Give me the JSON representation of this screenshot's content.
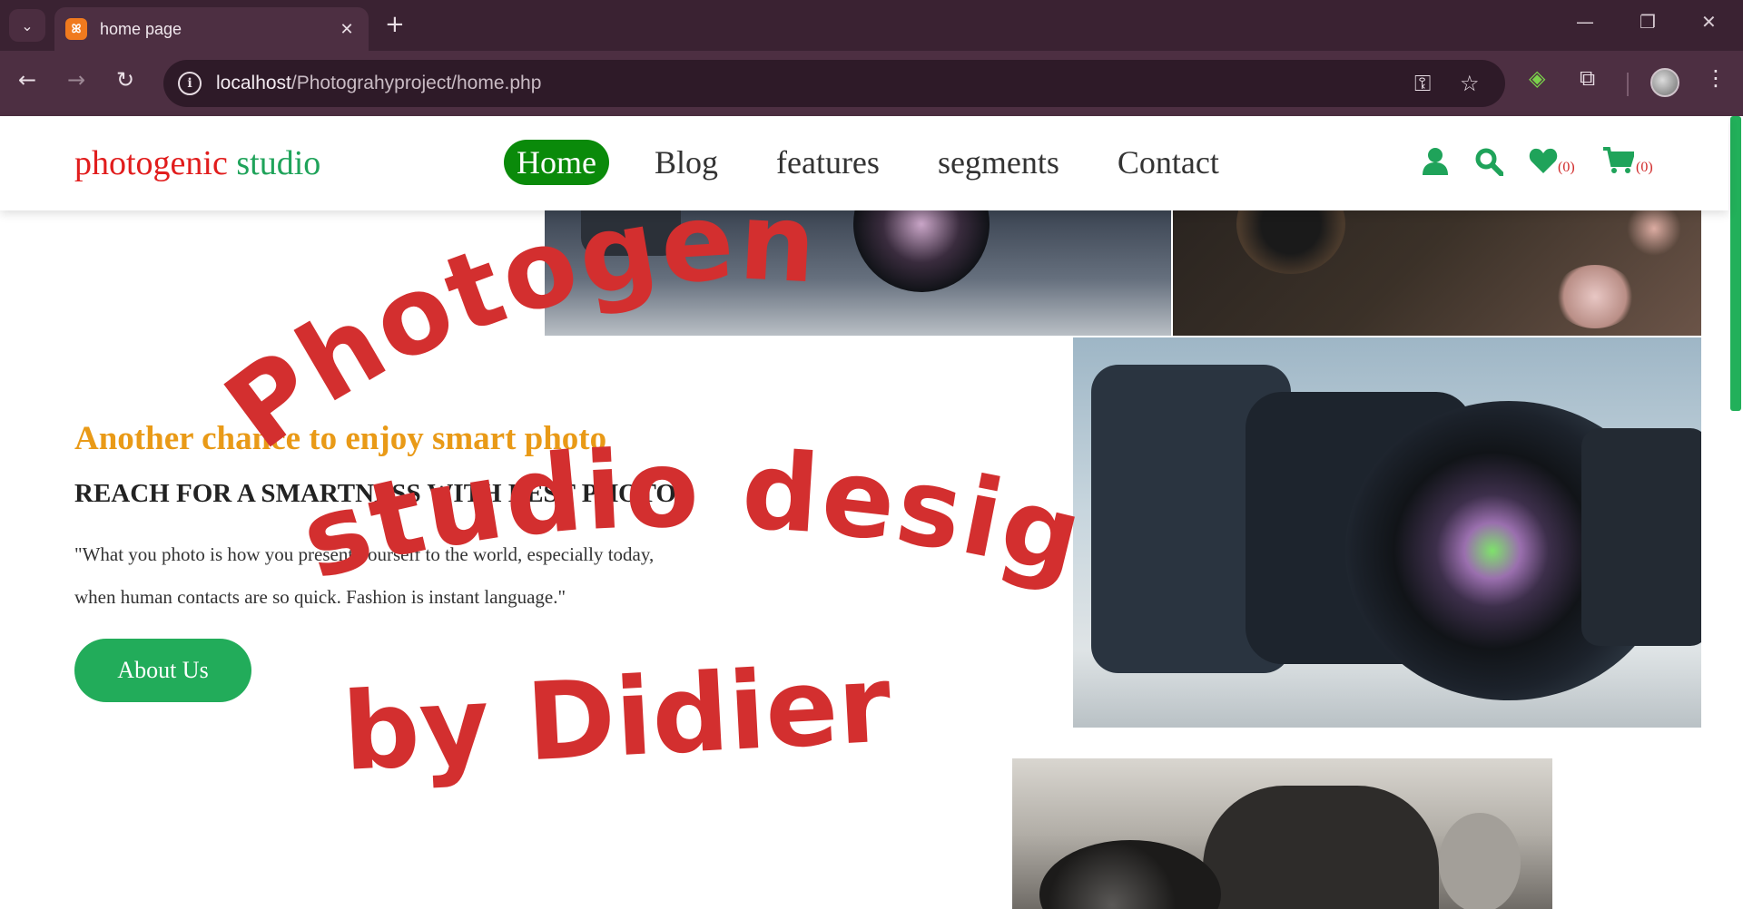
{
  "browser": {
    "tab_title": "home page",
    "url_host": "localhost",
    "url_path": "/Photograhyproject/home.php"
  },
  "site": {
    "logo_word1": "photogenic",
    "logo_word2": "studio",
    "nav": [
      "Home",
      "Blog",
      "features",
      "segments",
      "Contact"
    ],
    "active_nav": "Home",
    "wishlist_count": "(0)",
    "cart_count": "(0)"
  },
  "hero": {
    "tagline": "Another chance to enjoy smart photo",
    "headline": "REACH FOR A SMARTNESS WITH BEST PHOTOS",
    "quote_line1": "\"What you photo is how you present yourself to the world, especially today,",
    "quote_line2": "when human contacts are so quick. Fashion is instant language.\"",
    "button": "About Us"
  },
  "watermark": {
    "line1": "Photogenic",
    "line2": "studio designed",
    "line3": "by Didier"
  },
  "colors": {
    "brand_green": "#1fa35a",
    "brand_red": "#e11d1d",
    "tagline_orange": "#e99a17",
    "watermark_red": "#d32f2f"
  }
}
